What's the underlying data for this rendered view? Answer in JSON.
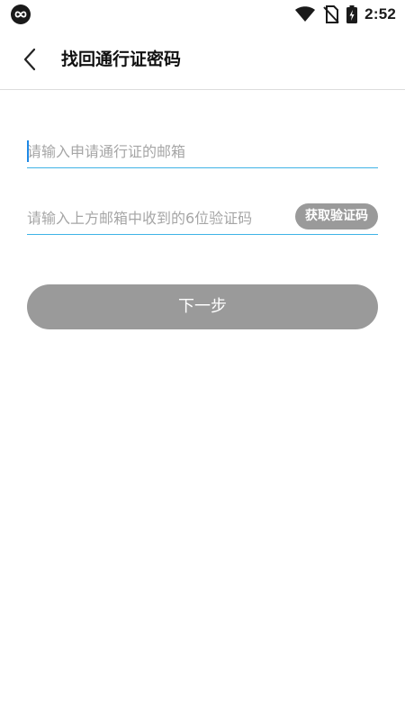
{
  "status_bar": {
    "time": "2:52",
    "icons": [
      "app-indicator-icon",
      "wifi-icon",
      "no-sim-icon",
      "battery-charging-icon"
    ]
  },
  "header": {
    "back_icon": "chevron-left-icon",
    "title": "找回通行证密码"
  },
  "form": {
    "email": {
      "placeholder": "请输入申请通行证的邮箱",
      "value": ""
    },
    "code": {
      "placeholder": "请输入上方邮箱中收到的6位验证码",
      "value": "",
      "get_code_label": "获取验证码"
    },
    "next_label": "下一步"
  },
  "colors": {
    "accent_underline": "#3fb3e6",
    "caret": "#1e88e5",
    "disabled_button": "#9a9a9a",
    "placeholder": "#a6a6a6"
  }
}
